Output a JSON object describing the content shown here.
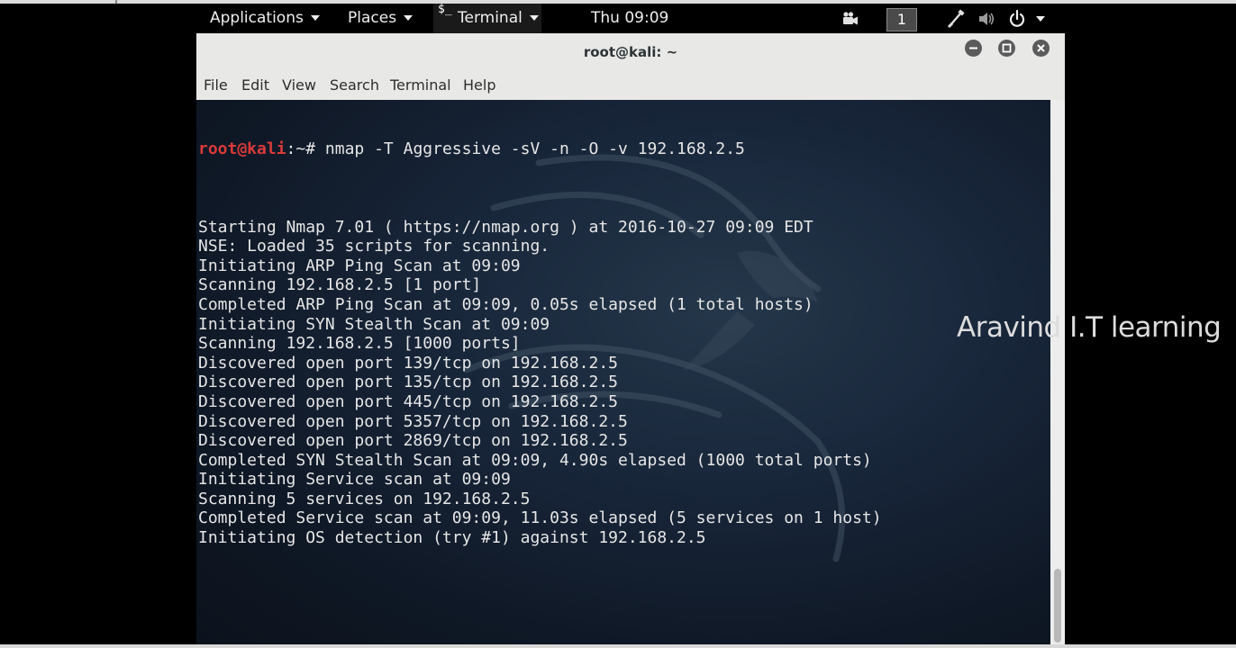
{
  "topbar": {
    "applications_label": "Applications",
    "places_label": "Places",
    "terminal_label": "Terminal",
    "terminal_icon_glyph": "$_",
    "clock": "Thu 09:09",
    "workspace_number": "1",
    "icons": [
      "camera-icon",
      "network-icon",
      "volume-icon",
      "power-icon",
      "chevron-down-icon"
    ]
  },
  "window": {
    "title": "root@kali: ~",
    "menu": [
      "File",
      "Edit",
      "View",
      "Search",
      "Terminal",
      "Help"
    ]
  },
  "terminal": {
    "prompt_user": "root@kali",
    "prompt_path": ":~# ",
    "command": "nmap -T Aggressive -sV -n -O -v 192.168.2.5",
    "output": [
      "",
      "Starting Nmap 7.01 ( https://nmap.org ) at 2016-10-27 09:09 EDT",
      "NSE: Loaded 35 scripts for scanning.",
      "Initiating ARP Ping Scan at 09:09",
      "Scanning 192.168.2.5 [1 port]",
      "Completed ARP Ping Scan at 09:09, 0.05s elapsed (1 total hosts)",
      "Initiating SYN Stealth Scan at 09:09",
      "Scanning 192.168.2.5 [1000 ports]",
      "Discovered open port 139/tcp on 192.168.2.5",
      "Discovered open port 135/tcp on 192.168.2.5",
      "Discovered open port 445/tcp on 192.168.2.5",
      "Discovered open port 5357/tcp on 192.168.2.5",
      "Discovered open port 2869/tcp on 192.168.2.5",
      "Completed SYN Stealth Scan at 09:09, 4.90s elapsed (1000 total ports)",
      "Initiating Service scan at 09:09",
      "Scanning 5 services on 192.168.2.5",
      "Completed Service scan at 09:09, 11.03s elapsed (5 services on 1 host)",
      "Initiating OS detection (try #1) against 192.168.2.5"
    ]
  },
  "watermark": "Aravind  I.T learning",
  "colors": {
    "prompt_user": "#d93a3a",
    "terminal_text": "#e6e6e6",
    "terminal_bg": "#18263a",
    "window_chrome": "#e8e8e7"
  }
}
